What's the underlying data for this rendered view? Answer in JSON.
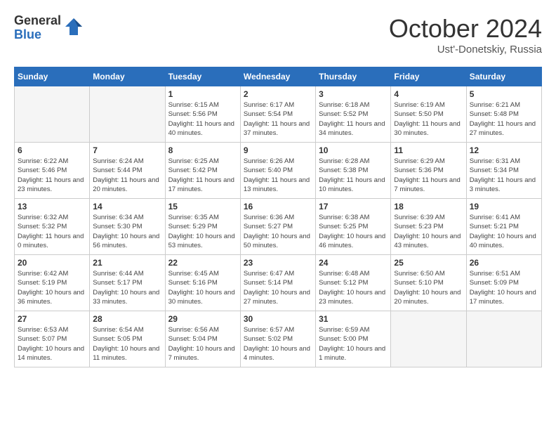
{
  "header": {
    "logo": {
      "general": "General",
      "blue": "Blue"
    },
    "title": "October 2024",
    "location": "Ust'-Donetskiy, Russia"
  },
  "days_of_week": [
    "Sunday",
    "Monday",
    "Tuesday",
    "Wednesday",
    "Thursday",
    "Friday",
    "Saturday"
  ],
  "weeks": [
    [
      {
        "day": null,
        "sunrise": "",
        "sunset": "",
        "daylight": ""
      },
      {
        "day": null,
        "sunrise": "",
        "sunset": "",
        "daylight": ""
      },
      {
        "day": "1",
        "sunrise": "Sunrise: 6:15 AM",
        "sunset": "Sunset: 5:56 PM",
        "daylight": "Daylight: 11 hours and 40 minutes."
      },
      {
        "day": "2",
        "sunrise": "Sunrise: 6:17 AM",
        "sunset": "Sunset: 5:54 PM",
        "daylight": "Daylight: 11 hours and 37 minutes."
      },
      {
        "day": "3",
        "sunrise": "Sunrise: 6:18 AM",
        "sunset": "Sunset: 5:52 PM",
        "daylight": "Daylight: 11 hours and 34 minutes."
      },
      {
        "day": "4",
        "sunrise": "Sunrise: 6:19 AM",
        "sunset": "Sunset: 5:50 PM",
        "daylight": "Daylight: 11 hours and 30 minutes."
      },
      {
        "day": "5",
        "sunrise": "Sunrise: 6:21 AM",
        "sunset": "Sunset: 5:48 PM",
        "daylight": "Daylight: 11 hours and 27 minutes."
      }
    ],
    [
      {
        "day": "6",
        "sunrise": "Sunrise: 6:22 AM",
        "sunset": "Sunset: 5:46 PM",
        "daylight": "Daylight: 11 hours and 23 minutes."
      },
      {
        "day": "7",
        "sunrise": "Sunrise: 6:24 AM",
        "sunset": "Sunset: 5:44 PM",
        "daylight": "Daylight: 11 hours and 20 minutes."
      },
      {
        "day": "8",
        "sunrise": "Sunrise: 6:25 AM",
        "sunset": "Sunset: 5:42 PM",
        "daylight": "Daylight: 11 hours and 17 minutes."
      },
      {
        "day": "9",
        "sunrise": "Sunrise: 6:26 AM",
        "sunset": "Sunset: 5:40 PM",
        "daylight": "Daylight: 11 hours and 13 minutes."
      },
      {
        "day": "10",
        "sunrise": "Sunrise: 6:28 AM",
        "sunset": "Sunset: 5:38 PM",
        "daylight": "Daylight: 11 hours and 10 minutes."
      },
      {
        "day": "11",
        "sunrise": "Sunrise: 6:29 AM",
        "sunset": "Sunset: 5:36 PM",
        "daylight": "Daylight: 11 hours and 7 minutes."
      },
      {
        "day": "12",
        "sunrise": "Sunrise: 6:31 AM",
        "sunset": "Sunset: 5:34 PM",
        "daylight": "Daylight: 11 hours and 3 minutes."
      }
    ],
    [
      {
        "day": "13",
        "sunrise": "Sunrise: 6:32 AM",
        "sunset": "Sunset: 5:32 PM",
        "daylight": "Daylight: 11 hours and 0 minutes."
      },
      {
        "day": "14",
        "sunrise": "Sunrise: 6:34 AM",
        "sunset": "Sunset: 5:30 PM",
        "daylight": "Daylight: 10 hours and 56 minutes."
      },
      {
        "day": "15",
        "sunrise": "Sunrise: 6:35 AM",
        "sunset": "Sunset: 5:29 PM",
        "daylight": "Daylight: 10 hours and 53 minutes."
      },
      {
        "day": "16",
        "sunrise": "Sunrise: 6:36 AM",
        "sunset": "Sunset: 5:27 PM",
        "daylight": "Daylight: 10 hours and 50 minutes."
      },
      {
        "day": "17",
        "sunrise": "Sunrise: 6:38 AM",
        "sunset": "Sunset: 5:25 PM",
        "daylight": "Daylight: 10 hours and 46 minutes."
      },
      {
        "day": "18",
        "sunrise": "Sunrise: 6:39 AM",
        "sunset": "Sunset: 5:23 PM",
        "daylight": "Daylight: 10 hours and 43 minutes."
      },
      {
        "day": "19",
        "sunrise": "Sunrise: 6:41 AM",
        "sunset": "Sunset: 5:21 PM",
        "daylight": "Daylight: 10 hours and 40 minutes."
      }
    ],
    [
      {
        "day": "20",
        "sunrise": "Sunrise: 6:42 AM",
        "sunset": "Sunset: 5:19 PM",
        "daylight": "Daylight: 10 hours and 36 minutes."
      },
      {
        "day": "21",
        "sunrise": "Sunrise: 6:44 AM",
        "sunset": "Sunset: 5:17 PM",
        "daylight": "Daylight: 10 hours and 33 minutes."
      },
      {
        "day": "22",
        "sunrise": "Sunrise: 6:45 AM",
        "sunset": "Sunset: 5:16 PM",
        "daylight": "Daylight: 10 hours and 30 minutes."
      },
      {
        "day": "23",
        "sunrise": "Sunrise: 6:47 AM",
        "sunset": "Sunset: 5:14 PM",
        "daylight": "Daylight: 10 hours and 27 minutes."
      },
      {
        "day": "24",
        "sunrise": "Sunrise: 6:48 AM",
        "sunset": "Sunset: 5:12 PM",
        "daylight": "Daylight: 10 hours and 23 minutes."
      },
      {
        "day": "25",
        "sunrise": "Sunrise: 6:50 AM",
        "sunset": "Sunset: 5:10 PM",
        "daylight": "Daylight: 10 hours and 20 minutes."
      },
      {
        "day": "26",
        "sunrise": "Sunrise: 6:51 AM",
        "sunset": "Sunset: 5:09 PM",
        "daylight": "Daylight: 10 hours and 17 minutes."
      }
    ],
    [
      {
        "day": "27",
        "sunrise": "Sunrise: 6:53 AM",
        "sunset": "Sunset: 5:07 PM",
        "daylight": "Daylight: 10 hours and 14 minutes."
      },
      {
        "day": "28",
        "sunrise": "Sunrise: 6:54 AM",
        "sunset": "Sunset: 5:05 PM",
        "daylight": "Daylight: 10 hours and 11 minutes."
      },
      {
        "day": "29",
        "sunrise": "Sunrise: 6:56 AM",
        "sunset": "Sunset: 5:04 PM",
        "daylight": "Daylight: 10 hours and 7 minutes."
      },
      {
        "day": "30",
        "sunrise": "Sunrise: 6:57 AM",
        "sunset": "Sunset: 5:02 PM",
        "daylight": "Daylight: 10 hours and 4 minutes."
      },
      {
        "day": "31",
        "sunrise": "Sunrise: 6:59 AM",
        "sunset": "Sunset: 5:00 PM",
        "daylight": "Daylight: 10 hours and 1 minute."
      },
      {
        "day": null,
        "sunrise": "",
        "sunset": "",
        "daylight": ""
      },
      {
        "day": null,
        "sunrise": "",
        "sunset": "",
        "daylight": ""
      }
    ]
  ]
}
